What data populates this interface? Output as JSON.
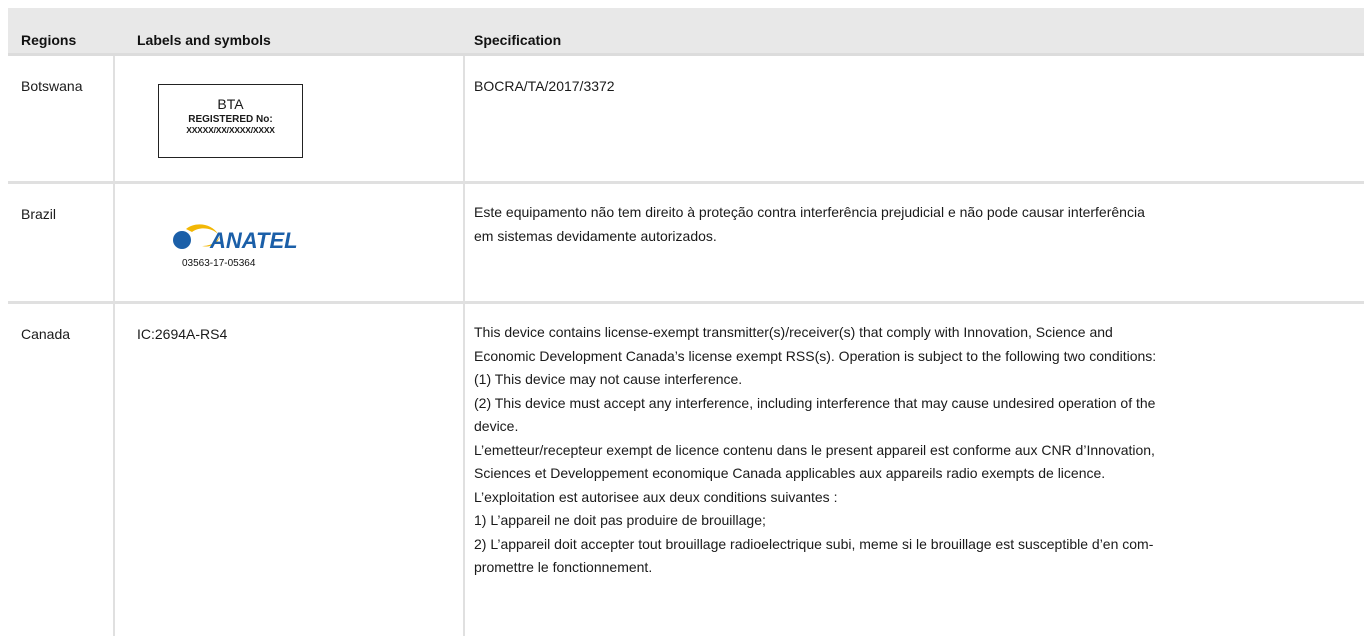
{
  "table": {
    "headers": {
      "regions": "Regions",
      "labels": "Labels and symbols",
      "specification": "Specification"
    },
    "rows": [
      {
        "region": "Botswana",
        "label": {
          "title": "BTA",
          "registered": "REGISTERED No:",
          "number": "XXXXX/XX/XXXX/XXXX"
        },
        "spec": "BOCRA/TA/2017/3372"
      },
      {
        "region": "Brazil",
        "label": {
          "logo_text": "ANATEL",
          "code": "03563-17-05364"
        },
        "spec_lines": [
          "Este equipamento não tem direito à proteção contra interferência prejudicial e não pode causar interferência",
          "em sistemas devidamente autorizados."
        ]
      },
      {
        "region": "Canada",
        "label": "IC:2694A-RS4",
        "spec_lines": [
          "This device contains license-exempt transmitter(s)/receiver(s) that comply with Innovation, Science and",
          "Economic Development Canada’s license exempt RSS(s). Operation is subject to the following two conditions:",
          "(1) This device may not cause interference.",
          "(2) This device must accept any interference, including interference that may cause undesired operation of the",
          "device.",
          "L’emetteur/recepteur exempt de licence contenu dans le present appareil est conforme aux CNR d’Innovation,",
          "Sciences et Developpement economique Canada applicables aux appareils radio exempts de licence.",
          "L’exploitation est autorisee aux deux conditions suivantes :",
          "1) L’appareil ne doit pas produire de brouillage;",
          "2) L’appareil doit accepter tout brouillage radioelectrique subi, meme si le brouillage est susceptible d’en com-",
          "promettre le fonctionnement."
        ]
      }
    ]
  },
  "colors": {
    "header_bg": "#e8e8e8",
    "rule": "#e0e0e0",
    "anatel_blue": "#1b5fa8",
    "anatel_yellow": "#f2b705"
  }
}
